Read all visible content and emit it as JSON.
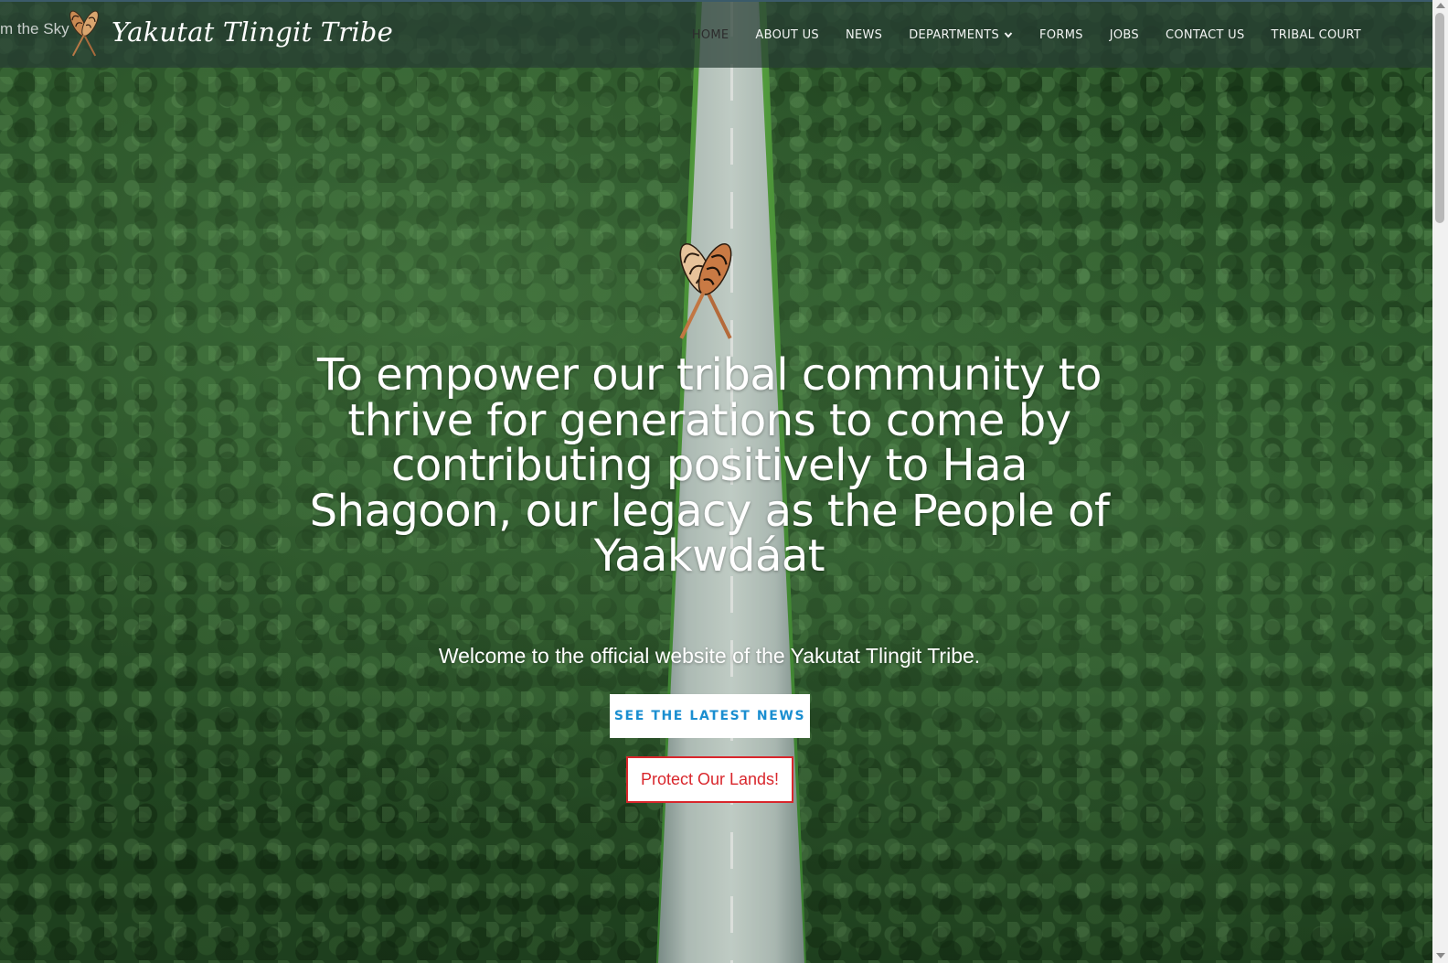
{
  "header": {
    "marquee_text": "m the Sky",
    "logo_icon": "crossed-paddles-icon",
    "site_title": "Yakutat Tlingit Tribe"
  },
  "nav": {
    "home": "HOME",
    "about": "ABOUT US",
    "news": "NEWS",
    "departments": "DEPARTMENTS",
    "forms": "FORMS",
    "jobs": "JOBS",
    "contact": "CONTACT US",
    "court": "TRIBAL COURT",
    "active_item": "HOME",
    "dropdown_icon": "chevron-down-icon"
  },
  "hero": {
    "mission": "To empower our tribal community to thrive for generations to come by contributing positively to Haa Shagoon, our legacy as the People of Yaakwdáat",
    "welcome": "Welcome to the official website of the Yakutat Tlingit Tribe.",
    "news_button": "SEE THE LATEST NEWS",
    "protect_button": "Protect Our Lands!",
    "logo_icon": "crossed-paddles-icon"
  },
  "colors": {
    "header_bg": "#283e34",
    "news_button_text": "#1a8ed0",
    "protect_button_border": "#d9262c",
    "forest": "#2d5a2c"
  }
}
